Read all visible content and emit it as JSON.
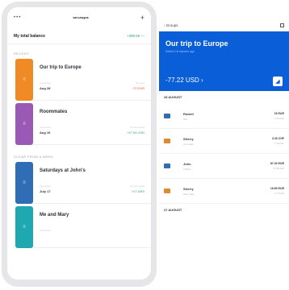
{
  "left": {
    "header": {
      "menu": "•••",
      "title": "Groups",
      "add": "+"
    },
    "balance": {
      "label": "My total balance",
      "amount": "+398.56 —"
    },
    "sections": [
      {
        "title": "RECENT",
        "groups": [
          {
            "name": "Our trip to Europe",
            "color": "#f08a24",
            "date": "Aug 28",
            "value": "-72 EUR",
            "value_kind": "neg",
            "caption": "Last active",
            "value_caption": "You owe"
          },
          {
            "name": "Roommates",
            "color": "#9b59b6",
            "date": "Aug 16",
            "value": "+47.95 USD",
            "value_kind": "pos",
            "caption": "Last active",
            "value_caption": "You are owed"
          }
        ]
      },
      {
        "title": "CLEAR FROM A WEEK",
        "groups": [
          {
            "name": "Saturdays at John's",
            "color": "#2f6db5",
            "date": "July 17",
            "value": "+27 ARS",
            "value_kind": "pos",
            "caption": "Last active",
            "value_caption": "You are owed"
          },
          {
            "name": "Me and Mary",
            "color": "#1fa8b0",
            "date": "",
            "value": "",
            "value_kind": "pos",
            "caption": "Last active",
            "value_caption": ""
          }
        ]
      }
    ]
  },
  "right": {
    "topbar": {
      "back": "‹ Groups"
    },
    "hero": {
      "title": "Our trip to Europe",
      "subtitle": "Settled 18 minutes ago",
      "amount": "-77.22 USD ›",
      "action": "◢"
    },
    "dates": [
      {
        "label": "28 AUGUST",
        "expenses": [
          {
            "who": "Robert",
            "what": "Bus",
            "amount": "18 EUR",
            "sub": "1.50 EUR",
            "icon_color": "#2f6db5"
          },
          {
            "who": "Sherry",
            "what": "Ice cream",
            "amount": "3.40 CHF",
            "sub": "1.70 CHF",
            "icon_color": "#e08a2c"
          },
          {
            "who": "John",
            "what": "Tickets",
            "amount": "87.40 EUR",
            "sub": "21.85 EUR",
            "icon_color": "#2f6db5"
          },
          {
            "who": "Sherry",
            "what": "Tasty gifts",
            "amount": "16.69 EUR",
            "sub": "4.17 EUR",
            "icon_color": "#e08a2c"
          }
        ]
      },
      {
        "label": "27 AUGUST",
        "expenses": []
      }
    ]
  }
}
